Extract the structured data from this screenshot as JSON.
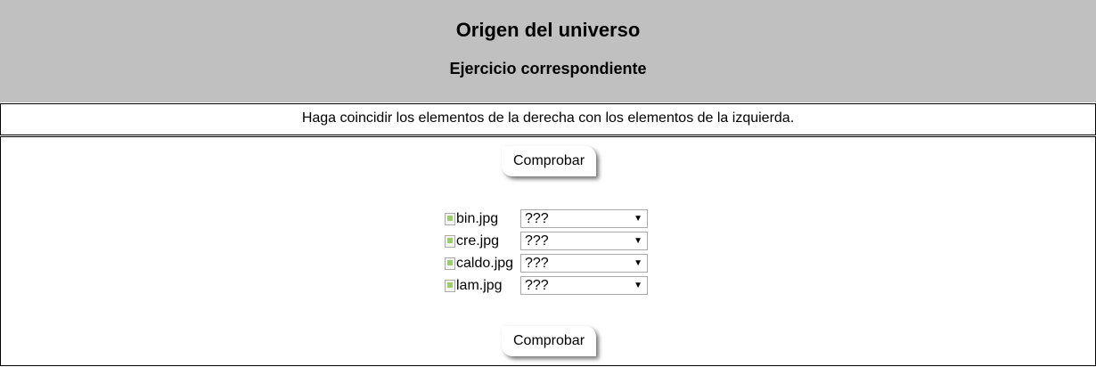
{
  "header": {
    "title": "Origen del universo",
    "subtitle": "Ejercicio correspondiente"
  },
  "instructions": "Haga coincidir los elementos de la derecha con los elementos de la izquierda.",
  "buttons": {
    "check_top": "Comprobar",
    "check_bottom": "Comprobar"
  },
  "rows": [
    {
      "image_alt": "bin.jpg",
      "selected": "???"
    },
    {
      "image_alt": "cre.jpg",
      "selected": "???"
    },
    {
      "image_alt": "caldo.jpg",
      "selected": "???"
    },
    {
      "image_alt": "lam.jpg",
      "selected": "???"
    }
  ],
  "icons": {
    "dropdown": "chevron-down-icon",
    "broken_image": "broken-image-icon"
  },
  "colors": {
    "header_bg": "#c0c0c0"
  }
}
